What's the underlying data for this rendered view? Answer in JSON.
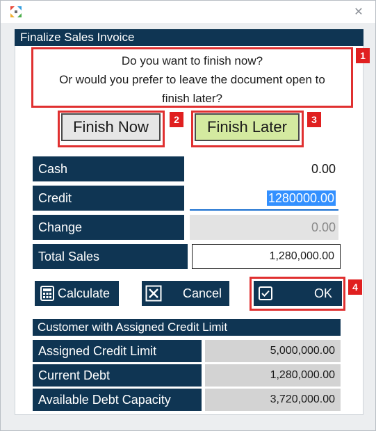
{
  "window": {
    "logo_icon": "app-logo-icon",
    "close_glyph": "✕",
    "close_icon": "close-icon"
  },
  "dialog": {
    "title": "Finalize Sales Invoice",
    "prompt_line1": "Do you want to finish now?",
    "prompt_line2": "Or would you prefer to leave the document open to",
    "prompt_line3": "finish later?"
  },
  "choices": {
    "finish_now": "Finish Now",
    "finish_later": "Finish Later"
  },
  "badges": [
    "1",
    "2",
    "3",
    "4"
  ],
  "fields": {
    "cash": {
      "label": "Cash",
      "value": "0.00"
    },
    "credit": {
      "label": "Credit",
      "value": "1280000.00"
    },
    "change": {
      "label": "Change",
      "value": "0.00"
    },
    "total_sales": {
      "label": "Total Sales",
      "value": "1,280,000.00"
    }
  },
  "actions": {
    "calculate": "Calculate",
    "cancel": "Cancel",
    "ok": "OK"
  },
  "credit_info": {
    "title": "Customer with Assigned Credit Limit",
    "assigned_limit": {
      "label": "Assigned Credit Limit",
      "value": "5,000,000.00"
    },
    "current_debt": {
      "label": "Current Debt",
      "value": "1,280,000.00"
    },
    "available_capacity": {
      "label": "Available Debt Capacity",
      "value": "3,720,000.00"
    }
  },
  "colors": {
    "navy": "#0f3553",
    "highlight_red": "#e03030",
    "finish_later_bg": "#d4eaa0",
    "finish_now_bg": "#e6e6e6",
    "selection_blue": "#3390ff"
  }
}
